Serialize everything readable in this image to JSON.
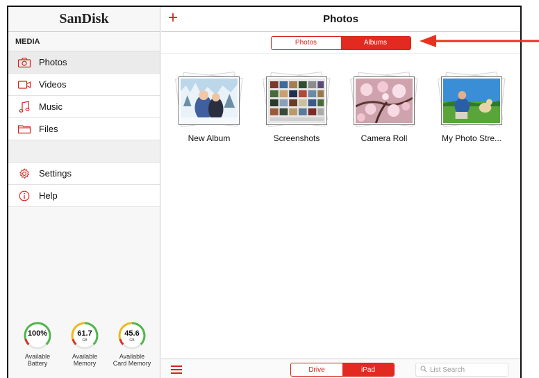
{
  "sidebar": {
    "brand": "SanDisk",
    "section_header": "MEDIA",
    "items": [
      {
        "label": "Photos",
        "icon": "camera-icon",
        "active": true
      },
      {
        "label": "Videos",
        "icon": "video-icon"
      },
      {
        "label": "Music",
        "icon": "music-note-icon"
      },
      {
        "label": "Files",
        "icon": "folder-icon"
      }
    ],
    "settings": [
      {
        "label": "Settings",
        "icon": "gear-icon"
      },
      {
        "label": "Help",
        "icon": "info-icon"
      }
    ],
    "gauges": [
      {
        "value": "100%",
        "unit": "",
        "label_line1": "Available",
        "label_line2": "Battery"
      },
      {
        "value": "61.7",
        "unit": "GB",
        "label_line1": "Available",
        "label_line2": "Memory"
      },
      {
        "value": "45.6",
        "unit": "GB",
        "label_line1": "Available",
        "label_line2": "Card Memory"
      }
    ]
  },
  "header": {
    "add_icon": "plus-icon",
    "title": "Photos"
  },
  "view_toggle": {
    "options": [
      "Photos",
      "Albums"
    ],
    "selected": "Albums"
  },
  "albums": [
    {
      "label": "New Album"
    },
    {
      "label": "Screenshots"
    },
    {
      "label": "Camera Roll"
    },
    {
      "label": "My Photo Stre..."
    }
  ],
  "bottom_bar": {
    "menu_icon": "hamburger-menu-icon",
    "source_toggle": [
      "Drive",
      "iPad"
    ],
    "source_selected": "iPad",
    "search_placeholder": "List Search"
  },
  "colors": {
    "accent": "#d6211c",
    "annotation_arrow": "#e8321f"
  }
}
